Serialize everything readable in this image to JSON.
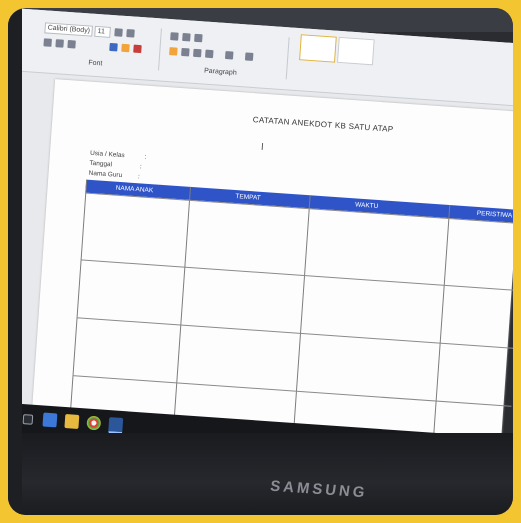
{
  "ribbon": {
    "font_name": "Calibri (Body)",
    "font_size": "11",
    "font_group_label": "Font",
    "paragraph_group_label": "Paragraph"
  },
  "document": {
    "title": "CATATAN ANEKDOT KB SATU ATAP",
    "fields": [
      {
        "label": "Usia / Kelas",
        "sep": ":"
      },
      {
        "label": "Tanggal",
        "sep": ":"
      },
      {
        "label": "Nama Guru",
        "sep": ":"
      }
    ],
    "table_headers": [
      "NAMA ANAK",
      "TEMPAT",
      "WAKTU",
      "PERISTIWA"
    ]
  },
  "monitor": {
    "brand": "SAMSUNG"
  },
  "colors": {
    "frame": "#f3c531",
    "table_header": "#2f54c8"
  }
}
